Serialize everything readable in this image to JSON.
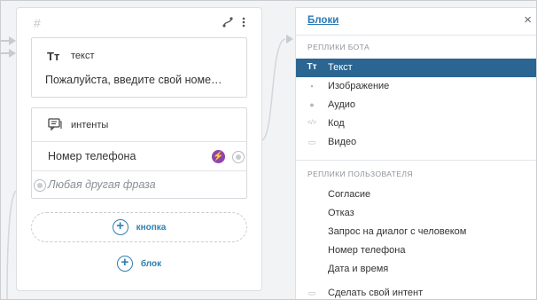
{
  "card": {
    "hash_icon": "#",
    "text_block": {
      "icon": "Tт",
      "title": "текст",
      "preview": "Пожалуйста, введите свой номер телефона"
    },
    "intents_block": {
      "title": "интенты",
      "rows": [
        {
          "label": "Номер телефона"
        },
        {
          "label": "Любая другая фраза"
        }
      ]
    },
    "add_button_label": "кнопка",
    "add_block_label": "блок"
  },
  "panel": {
    "title": "Блоки",
    "bot_section_label": "реплики бота",
    "bot_items": [
      {
        "icon": "Tт",
        "label": "Текст",
        "selected": true
      },
      {
        "icon": "▪",
        "label": "Изображение"
      },
      {
        "icon": "●",
        "label": "Аудио"
      },
      {
        "icon": "</>",
        "label": "Код"
      },
      {
        "icon": "▭",
        "label": "Видео"
      }
    ],
    "user_section_label": "реплики пользователя",
    "user_items": [
      {
        "label": "Согласие"
      },
      {
        "label": "Отказ"
      },
      {
        "label": "Запрос на диалог с человеком"
      },
      {
        "label": "Номер телефона"
      },
      {
        "label": "Дата и время"
      },
      {
        "label": "Сделать свой интент",
        "icon": "▭"
      }
    ]
  },
  "colors": {
    "accent": "#2a79b5",
    "selected_bg": "#2b6592",
    "bolt_bg": "#8e44ad"
  }
}
